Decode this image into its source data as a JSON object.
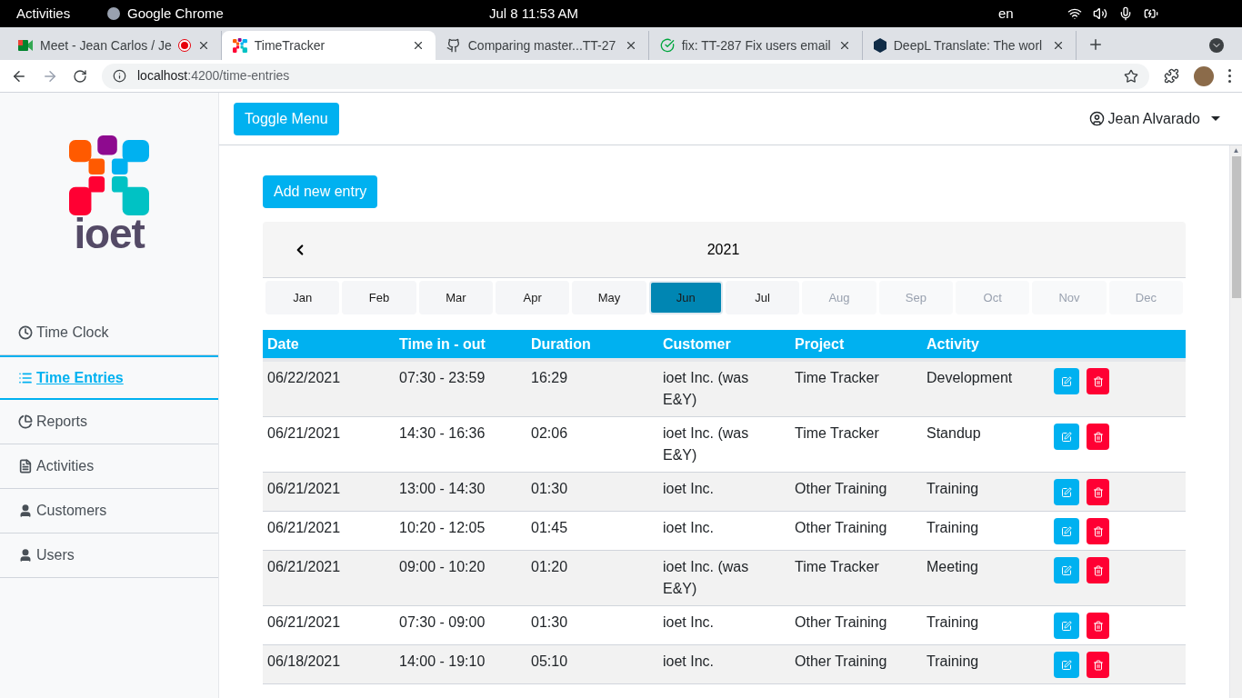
{
  "system_bar": {
    "activities": "Activities",
    "app": "Google Chrome",
    "clock": "Jul 8  11:53 AM",
    "lang": "en"
  },
  "browser": {
    "tabs": [
      {
        "title": "Meet - Jean Carlos / Je",
        "selected": false,
        "kind": "meet",
        "recording": true
      },
      {
        "title": "TimeTracker",
        "selected": true,
        "kind": "ioet",
        "recording": false
      },
      {
        "title": "Comparing master...TT-27",
        "selected": false,
        "kind": "github",
        "recording": false
      },
      {
        "title": "fix: TT-287 Fix users email",
        "selected": false,
        "kind": "check",
        "recording": false
      },
      {
        "title": "DeepL Translate: The worl",
        "selected": false,
        "kind": "deepl",
        "recording": false
      }
    ],
    "url_host": "localhost",
    "url_path": ":4200/time-entries"
  },
  "sidebar": {
    "logo_text": "ioet",
    "items": [
      {
        "label": "Time Clock",
        "kind": "clock",
        "selected": false
      },
      {
        "label": "Time Entries",
        "kind": "list",
        "selected": true
      },
      {
        "label": "Reports",
        "kind": "pie",
        "selected": false
      },
      {
        "label": "Activities",
        "kind": "file",
        "selected": false
      },
      {
        "label": "Customers",
        "kind": "user",
        "selected": false
      },
      {
        "label": "Users",
        "kind": "user",
        "selected": false
      }
    ]
  },
  "scroll_up": "▲",
  "header": {
    "toggle_button": "Toggle Menu",
    "user": "Jean Alvarado"
  },
  "add_button": "Add new entry",
  "calendar": {
    "year": "2021",
    "months": [
      {
        "label": "Jan",
        "selected": false,
        "disabled": false
      },
      {
        "label": "Feb",
        "selected": false,
        "disabled": false
      },
      {
        "label": "Mar",
        "selected": false,
        "disabled": false
      },
      {
        "label": "Apr",
        "selected": false,
        "disabled": false
      },
      {
        "label": "May",
        "selected": false,
        "disabled": false
      },
      {
        "label": "Jun",
        "selected": true,
        "disabled": false
      },
      {
        "label": "Jul",
        "selected": false,
        "disabled": false
      },
      {
        "label": "Aug",
        "selected": false,
        "disabled": true
      },
      {
        "label": "Sep",
        "selected": false,
        "disabled": true
      },
      {
        "label": "Oct",
        "selected": false,
        "disabled": true
      },
      {
        "label": "Nov",
        "selected": false,
        "disabled": true
      },
      {
        "label": "Dec",
        "selected": false,
        "disabled": true
      }
    ]
  },
  "table": {
    "columns": [
      "Date",
      "Time in - out",
      "Duration",
      "Customer",
      "Project",
      "Activity"
    ],
    "rows": [
      [
        "06/22/2021",
        "07:30 - 23:59",
        "16:29",
        "ioet Inc. (was E&Y)",
        "Time Tracker",
        "Development"
      ],
      [
        "06/21/2021",
        "14:30 - 16:36",
        "02:06",
        "ioet Inc. (was E&Y)",
        "Time Tracker",
        "Standup"
      ],
      [
        "06/21/2021",
        "13:00 - 14:30",
        "01:30",
        "ioet Inc.",
        "Other Training",
        "Training"
      ],
      [
        "06/21/2021",
        "10:20 - 12:05",
        "01:45",
        "ioet Inc.",
        "Other Training",
        "Training"
      ],
      [
        "06/21/2021",
        "09:00 - 10:20",
        "01:20",
        "ioet Inc. (was E&Y)",
        "Time Tracker",
        "Meeting"
      ],
      [
        "06/21/2021",
        "07:30 - 09:00",
        "01:30",
        "ioet Inc.",
        "Other Training",
        "Training"
      ],
      [
        "06/18/2021",
        "14:00 - 19:10",
        "05:10",
        "ioet Inc.",
        "Other Training",
        "Training"
      ]
    ]
  }
}
